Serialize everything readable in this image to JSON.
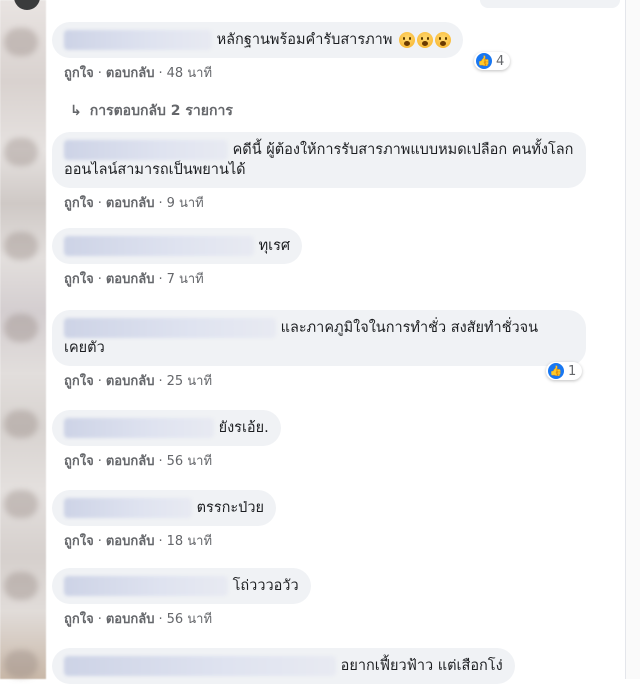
{
  "comments": [
    {
      "text": "หลักฐานพร้อมคำรับสารภาพ",
      "reaction_count": "4",
      "like": "ถูกใจ",
      "reply": "ตอบกลับ",
      "time": "48 นาที"
    },
    {
      "text": "คดีนี้ ผู้ต้องให้การรับสารภาพแบบหมดเปลือก คนทั้งโลกออนไลน์สามารถเป็นพยานได้",
      "like": "ถูกใจ",
      "reply": "ตอบกลับ",
      "time": "9 นาที"
    },
    {
      "text": "ทุเรศ",
      "like": "ถูกใจ",
      "reply": "ตอบกลับ",
      "time": "7 นาที"
    },
    {
      "text": "และภาคภูมิใจในการทำชั่ว สงสัยทำชั่วจนเคยตัว",
      "reaction_count": "1",
      "like": "ถูกใจ",
      "reply": "ตอบกลับ",
      "time": "25 นาที"
    },
    {
      "text": "ยังรเอ้ย.",
      "like": "ถูกใจ",
      "reply": "ตอบกลับ",
      "time": "56 นาที"
    },
    {
      "text": "ตรรกะป่วย",
      "like": "ถูกใจ",
      "reply": "ตอบกลับ",
      "time": "18 นาที"
    },
    {
      "text": "โถ่วววอวัว",
      "like": "ถูกใจ",
      "reply": "ตอบกลับ",
      "time": "56 นาที"
    },
    {
      "text": "อยากเฟี้ยวฟ้าว แต่เสือกโง่"
    }
  ],
  "replies_link": "การตอบกลับ 2 รายการ",
  "colors": {
    "bubble": "#f0f2f5",
    "meta": "#65676b",
    "like_blue": "#1877f2"
  },
  "icons": {
    "like": "thumbs-up-icon",
    "reply_arrow": "reply-arrow-icon",
    "emoji": "surprised-face-icon"
  }
}
